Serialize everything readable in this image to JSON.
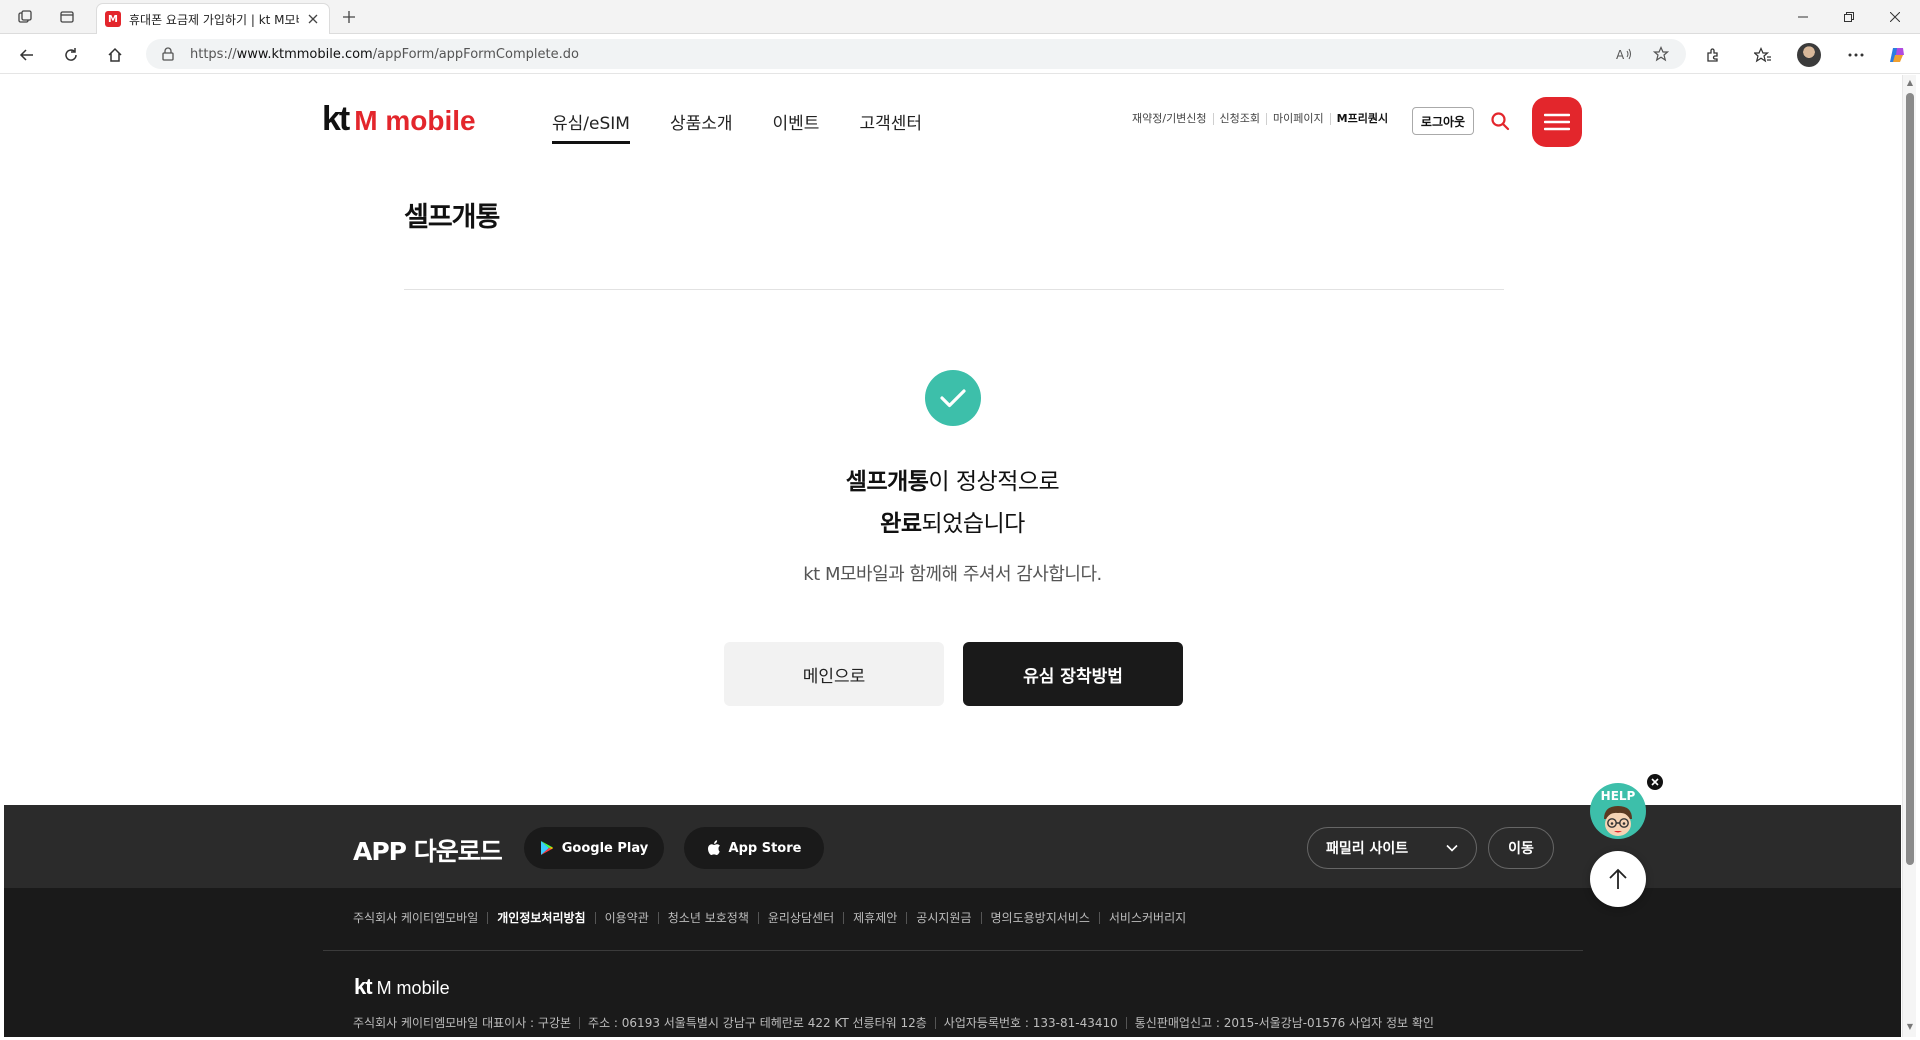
{
  "browser": {
    "tab_title": "휴대폰 요금제 가입하기 | kt M모바일",
    "tab_favicon": "M",
    "url_prefix": "https://",
    "url_host": "www.ktmmobile.com",
    "url_path": "/appForm/appFormComplete.do"
  },
  "header": {
    "logo_kt": "kt",
    "logo_m": "M mobile",
    "nav": [
      {
        "label": "유심/eSIM"
      },
      {
        "label": "상품소개"
      },
      {
        "label": "이벤트"
      },
      {
        "label": "고객센터"
      }
    ],
    "util": [
      {
        "label": "재약정/기변신청"
      },
      {
        "label": "신청조회"
      },
      {
        "label": "마이페이지"
      },
      {
        "label": "M프리퀀시"
      }
    ],
    "logout_label": "로그아웃"
  },
  "main": {
    "title": "셀프개통",
    "msg_bold1": "셀프개통",
    "msg_rest1": "이 정상적으로",
    "msg_bold2": "완료",
    "msg_rest2": "되었습니다",
    "msg_sub": "kt M모바일과 함께해 주셔서 감사합니다.",
    "btn_main": "메인으로",
    "btn_sim": "유심 장착방법"
  },
  "footer": {
    "app_download": "APP 다운로드",
    "google_play": "Google Play",
    "app_store": "App Store",
    "family_site": "패밀리 사이트",
    "go_label": "이동",
    "links": [
      {
        "label": "주식회사 케이티엠모바일"
      },
      {
        "label": "개인정보처리방침"
      },
      {
        "label": "이용약관"
      },
      {
        "label": "청소년 보호정책"
      },
      {
        "label": "윤리상담센터"
      },
      {
        "label": "제휴제안"
      },
      {
        "label": "공시지원금"
      },
      {
        "label": "명의도용방지서비스"
      },
      {
        "label": "서비스커버리지"
      }
    ],
    "logo_kt": "kt",
    "logo_m": "M mobile",
    "info": [
      "주식회사 케이티엠모바일 대표이사 : 구강본",
      "주소 : 06193 서울특별시 강남구 테헤란로 422 KT 선릉타워 12층",
      "사업자등록번호 : 133-81-43410",
      "통신판매업신고 : 2015-서울강남-01576 사업자 정보 확인"
    ]
  },
  "floating": {
    "help_label": "HELP"
  },
  "colors": {
    "brand_red": "#e3262c",
    "success_teal": "#3dbfaa",
    "dark": "#1a1a1a"
  }
}
